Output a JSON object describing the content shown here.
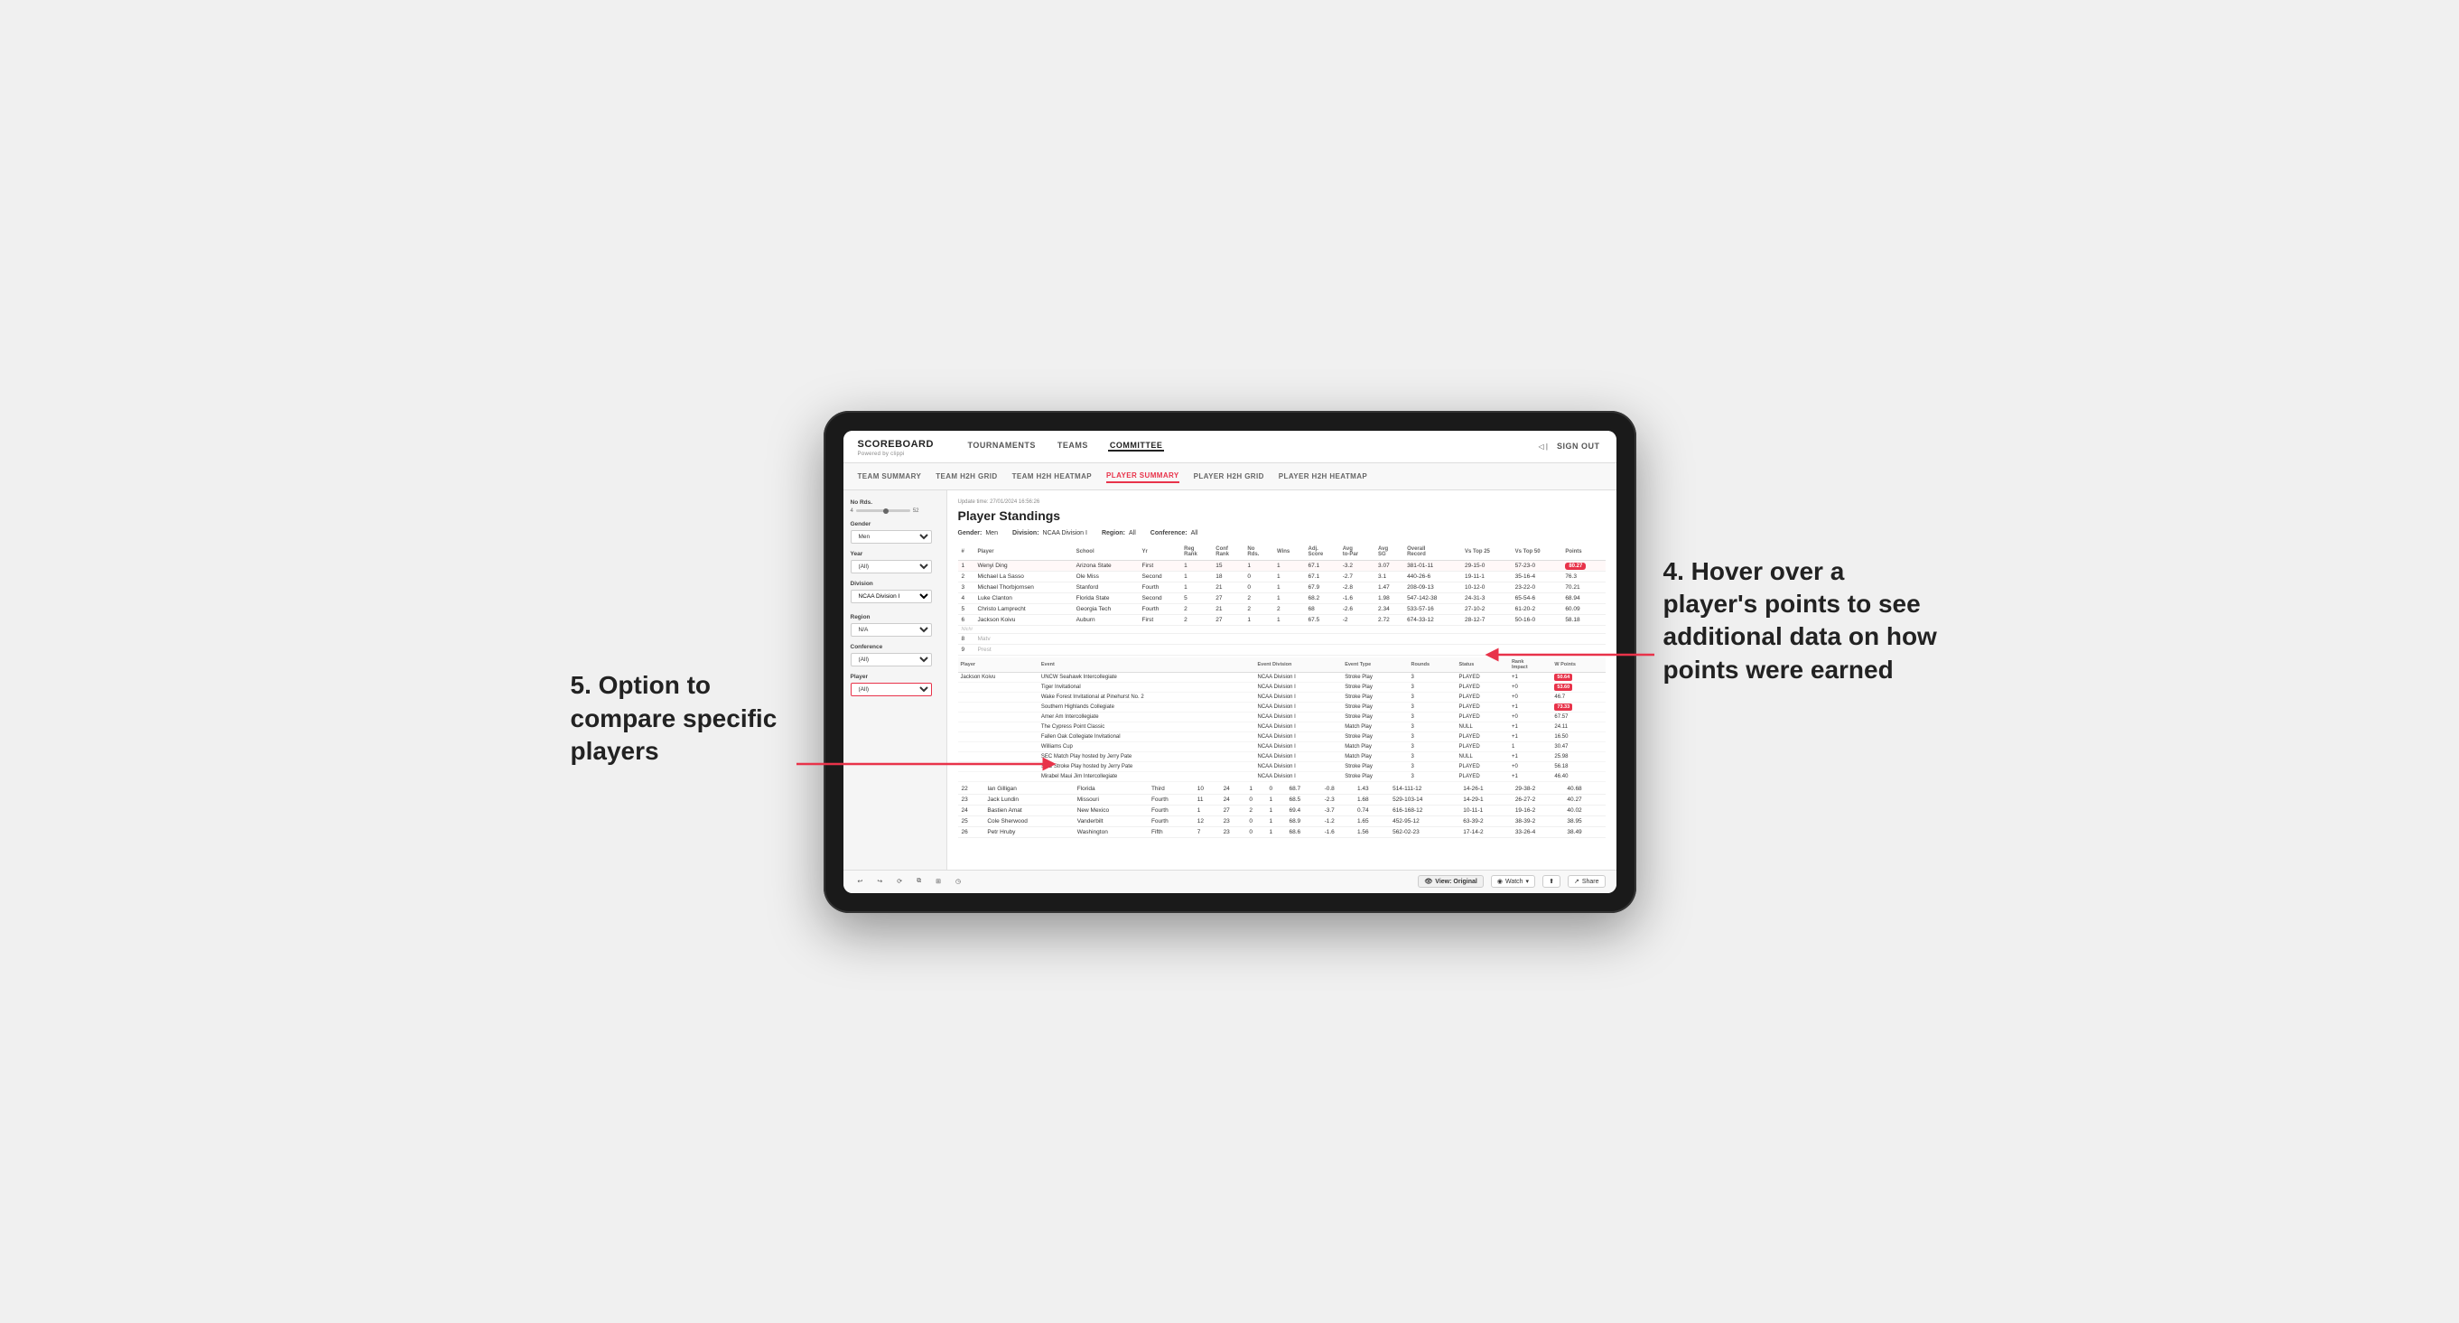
{
  "app": {
    "logo": "SCOREBOARD",
    "logo_sub": "Powered by clippi",
    "sign_out": "Sign out"
  },
  "nav": {
    "links": [
      "TOURNAMENTS",
      "TEAMS",
      "COMMITTEE"
    ],
    "active": "COMMITTEE"
  },
  "sub_nav": {
    "links": [
      "TEAM SUMMARY",
      "TEAM H2H GRID",
      "TEAM H2H HEATMAP",
      "PLAYER SUMMARY",
      "PLAYER H2H GRID",
      "PLAYER H2H HEATMAP"
    ],
    "active": "PLAYER SUMMARY"
  },
  "sidebar": {
    "no_rds_label": "No Rds.",
    "no_rds_min": "4",
    "no_rds_max": "52",
    "gender_label": "Gender",
    "gender_value": "Men",
    "year_label": "Year",
    "year_value": "(All)",
    "division_label": "Division",
    "division_value": "NCAA Division I",
    "region_label": "Region",
    "region_value": "N/A",
    "conference_label": "Conference",
    "conference_value": "(All)",
    "player_label": "Player",
    "player_value": "(All)"
  },
  "content": {
    "update_time": "Update time: 27/01/2024 16:56:26",
    "title": "Player Standings",
    "filters": {
      "gender_label": "Gender:",
      "gender_value": "Men",
      "division_label": "Division:",
      "division_value": "NCAA Division I",
      "region_label": "Region:",
      "region_value": "All",
      "conference_label": "Conference:",
      "conference_value": "All"
    },
    "table_headers": [
      "#",
      "Player",
      "School",
      "Yr",
      "Reg Rank",
      "Conf Rank",
      "No Rds.",
      "Wins",
      "Adj. Score",
      "Avg to-Par",
      "Avg SG",
      "Overall Record",
      "Vs Top 25",
      "Vs Top 50",
      "Points"
    ],
    "players": [
      {
        "rank": 1,
        "name": "Wenyi Ding",
        "school": "Arizona State",
        "yr": "First",
        "reg_rank": 1,
        "conf_rank": 15,
        "no_rds": 1,
        "wins": 1,
        "adj_score": 67.1,
        "avg_topar": -3.2,
        "avg_sg": 3.07,
        "record": "381-01-11",
        "vs_top25": "29-15-0",
        "vs_top50": "57-23-0",
        "points": "80.27",
        "highlight": true
      },
      {
        "rank": 2,
        "name": "Michael La Sasso",
        "school": "Ole Miss",
        "yr": "Second",
        "reg_rank": 1,
        "conf_rank": 18,
        "no_rds": 0,
        "wins": 1,
        "adj_score": 67.1,
        "avg_topar": -2.7,
        "avg_sg": 3.1,
        "record": "440-26-6",
        "vs_top25": "19-11-1",
        "vs_top50": "35-16-4",
        "points": "76.3"
      },
      {
        "rank": 3,
        "name": "Michael Thorbjornsen",
        "school": "Stanford",
        "yr": "Fourth",
        "reg_rank": 1,
        "conf_rank": 21,
        "no_rds": 0,
        "wins": 1,
        "adj_score": 67.9,
        "avg_topar": -2.8,
        "avg_sg": 1.47,
        "record": "208-09-13",
        "vs_top25": "10-12-0",
        "vs_top50": "23-22-0",
        "points": "70.21"
      },
      {
        "rank": 4,
        "name": "Luke Clanton",
        "school": "Florida State",
        "yr": "Second",
        "reg_rank": 5,
        "conf_rank": 27,
        "no_rds": 2,
        "wins": 1,
        "adj_score": 68.2,
        "avg_topar": -1.6,
        "avg_sg": 1.98,
        "record": "547-142-38",
        "vs_top25": "24-31-3",
        "vs_top50": "65-54-6",
        "points": "68.94"
      },
      {
        "rank": 5,
        "name": "Christo Lamprecht",
        "school": "Georgia Tech",
        "yr": "Fourth",
        "reg_rank": 2,
        "conf_rank": 21,
        "no_rds": 2,
        "wins": 2,
        "adj_score": 68.0,
        "avg_topar": -2.6,
        "avg_sg": 2.34,
        "record": "533-57-16",
        "vs_top25": "27-10-2",
        "vs_top50": "61-20-2",
        "points": "60.09"
      },
      {
        "rank": 6,
        "name": "Jackson Koivu",
        "school": "Auburn",
        "yr": "First",
        "reg_rank": 2,
        "conf_rank": 27,
        "no_rds": 1,
        "wins": 1,
        "adj_score": 67.5,
        "avg_topar": -2.0,
        "avg_sg": 2.72,
        "record": "674-33-12",
        "vs_top25": "28-12-7",
        "vs_top50": "50-16-0",
        "points": "58.18"
      },
      {
        "rank": 7,
        "name": "Nichi",
        "school": "",
        "yr": "",
        "reg_rank": "",
        "conf_rank": "",
        "no_rds": "",
        "wins": "",
        "adj_score": "",
        "avg_topar": "",
        "avg_sg": "",
        "record": "",
        "vs_top25": "",
        "vs_top50": "",
        "points": "",
        "divider": true
      },
      {
        "rank": 8,
        "name": "Matv",
        "school": "",
        "yr": "",
        "points": ""
      },
      {
        "rank": 9,
        "name": "Prest",
        "school": "",
        "yr": "",
        "points": ""
      }
    ]
  },
  "event_section": {
    "player_name": "Jackson Koivu",
    "headers": [
      "Player",
      "Event",
      "Event Division",
      "Event Type",
      "Rounds",
      "Status",
      "Rank Impact",
      "W Points"
    ],
    "events": [
      {
        "player": "Jackson Koivu",
        "event": "UNCW Seahawk Intercollegiate",
        "division": "NCAA Division I",
        "type": "Stroke Play",
        "rounds": 3,
        "status": "PLAYED",
        "rank_impact": "+1",
        "w_points": "50.64"
      },
      {
        "player": "",
        "event": "Tiger Invitational",
        "division": "NCAA Division I",
        "type": "Stroke Play",
        "rounds": 3,
        "status": "PLAYED",
        "rank_impact": "+0",
        "w_points": "53.60"
      },
      {
        "player": "",
        "event": "Wake Forest Invitational at Pinehurst No. 2",
        "division": "NCAA Division I",
        "type": "Stroke Play",
        "rounds": 3,
        "status": "PLAYED",
        "rank_impact": "+0",
        "w_points": "46.7"
      },
      {
        "player": "",
        "event": "Southern Highlands Collegiate",
        "division": "NCAA Division I",
        "type": "Stroke Play",
        "rounds": 3,
        "status": "PLAYED",
        "rank_impact": "+1",
        "w_points": "73.33"
      },
      {
        "player": "",
        "event": "Amer Am Intercollegiate",
        "division": "NCAA Division I",
        "type": "Stroke Play",
        "rounds": 3,
        "status": "PLAYED",
        "rank_impact": "+0",
        "w_points": "67.57"
      },
      {
        "player": "",
        "event": "The Cypress Point Classic",
        "division": "NCAA Division I",
        "type": "Match Play",
        "rounds": 3,
        "status": "NULL",
        "rank_impact": "+1",
        "w_points": "24.11"
      },
      {
        "player": "",
        "event": "Fallen Oak Collegiate Invitational",
        "division": "NCAA Division I",
        "type": "Stroke Play",
        "rounds": 3,
        "status": "PLAYED",
        "rank_impact": "+1",
        "w_points": "16.50"
      },
      {
        "player": "",
        "event": "Williams Cup",
        "division": "NCAA Division I",
        "type": "Match Play",
        "rounds": 3,
        "status": "PLAYED",
        "rank_impact": "1",
        "w_points": "30.47"
      },
      {
        "player": "",
        "event": "SEC Match Play hosted by Jerry Pate",
        "division": "NCAA Division I",
        "type": "Match Play",
        "rounds": 3,
        "status": "NULL",
        "rank_impact": "+1",
        "w_points": "25.98"
      },
      {
        "player": "",
        "event": "SEC Stroke Play hosted by Jerry Pate",
        "division": "NCAA Division I",
        "type": "Stroke Play",
        "rounds": 3,
        "status": "PLAYED",
        "rank_impact": "+0",
        "w_points": "56.18"
      },
      {
        "player": "",
        "event": "Mirabel Maui Jim Intercollegiate",
        "division": "NCAA Division I",
        "type": "Stroke Play",
        "rounds": 3,
        "status": "PLAYED",
        "rank_impact": "+1",
        "w_points": "46.40"
      }
    ],
    "more_players": [
      {
        "rank": 22,
        "name": "Ian Gilligan",
        "school": "Florida",
        "yr": "Third",
        "reg_rank": 10,
        "conf_rank": 24,
        "no_rds": 1,
        "wins": 0,
        "adj_score": 68.7,
        "avg_topar": -0.8,
        "avg_sg": 1.43,
        "record": "514-111-12",
        "vs_top25": "14-26-1",
        "vs_top50": "29-38-2",
        "points": "40.68"
      },
      {
        "rank": 23,
        "name": "Jack Lundin",
        "school": "Missouri",
        "yr": "Fourth",
        "reg_rank": 11,
        "conf_rank": 24,
        "no_rds": 0,
        "wins": 1,
        "adj_score": 68.5,
        "avg_topar": -2.3,
        "avg_sg": 1.68,
        "record": "529-103-14",
        "vs_top25": "14-29-1",
        "vs_top50": "26-27-2",
        "points": "40.27"
      },
      {
        "rank": 24,
        "name": "Bastien Amat",
        "school": "New Mexico",
        "yr": "Fourth",
        "reg_rank": 1,
        "conf_rank": 27,
        "no_rds": 2,
        "wins": 1,
        "adj_score": 69.4,
        "avg_topar": -3.7,
        "avg_sg": 0.74,
        "record": "616-168-12",
        "vs_top25": "10-11-1",
        "vs_top50": "19-16-2",
        "points": "40.02"
      },
      {
        "rank": 25,
        "name": "Cole Sherwood",
        "school": "Vanderbilt",
        "yr": "Fourth",
        "reg_rank": 12,
        "conf_rank": 23,
        "no_rds": 0,
        "wins": 1,
        "adj_score": 68.9,
        "avg_topar": -1.2,
        "avg_sg": 1.65,
        "record": "452-95-12",
        "vs_top25": "63-39-2",
        "vs_top50": "38-39-2",
        "points": "38.95"
      },
      {
        "rank": 26,
        "name": "Petr Hruby",
        "school": "Washington",
        "yr": "Fifth",
        "reg_rank": 7,
        "conf_rank": 23,
        "no_rds": 0,
        "wins": 1,
        "adj_score": 68.6,
        "avg_topar": -1.6,
        "avg_sg": 1.56,
        "record": "562-02-23",
        "vs_top25": "17-14-2",
        "vs_top50": "33-26-4",
        "points": "38.49"
      }
    ]
  },
  "bottom_bar": {
    "view_original": "View: Original",
    "watch": "Watch",
    "share": "Share"
  },
  "annotations": {
    "right_text": "4. Hover over a player's points to see additional data on how points were earned",
    "left_text": "5. Option to compare specific players"
  }
}
